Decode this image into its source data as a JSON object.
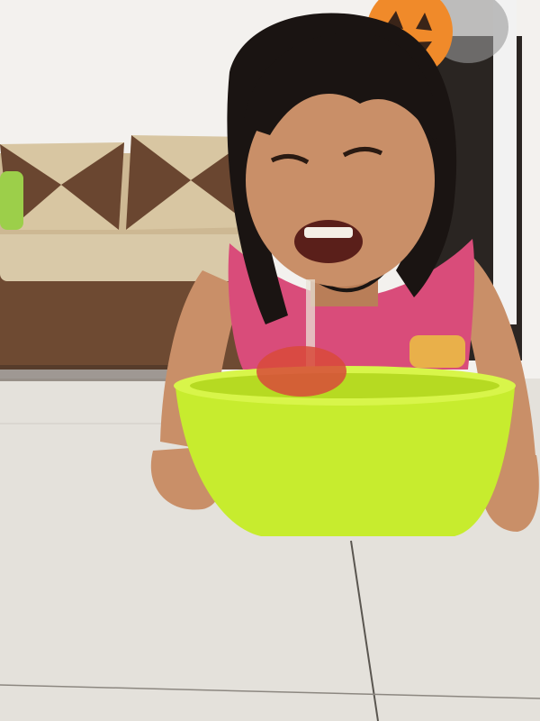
{
  "photo": {
    "subject": "",
    "colors": {
      "wall": "#f3f1ee",
      "floor": "#e4e1db",
      "floor_grout": "#5a5650",
      "sofa_base": "#6e4a32",
      "sofa_seat": "#d9c9a8",
      "cushion_light": "#d8c6a2",
      "cushion_dark": "#6a4630",
      "cushion_green": "#9ccf4a",
      "hair": "#1a1412",
      "skin": "#c98f68",
      "top_pink": "#d94c7a",
      "bowl": "#c7ec2e",
      "bowl_rim": "#d8f54a",
      "apple": "#d84a3a",
      "pumpkin": "#f08a2a",
      "fan_pole": "#f2f2f2",
      "cabinet": "#2a2522"
    }
  }
}
